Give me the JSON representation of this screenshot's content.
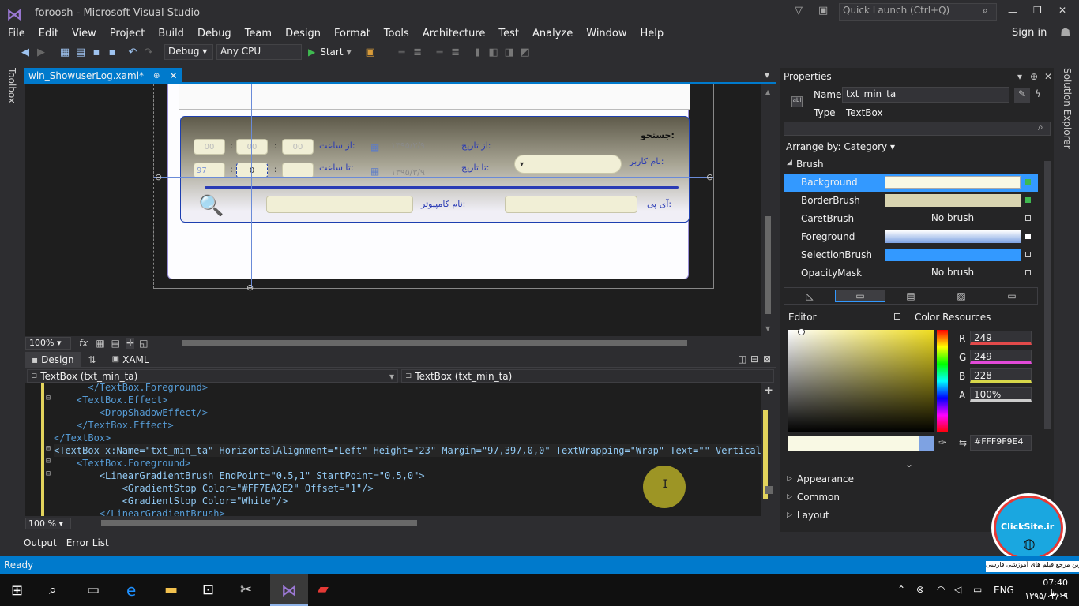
{
  "window": {
    "title": "foroosh - Microsoft Visual Studio",
    "quick_launch": "Quick Launch (Ctrl+Q)",
    "sign_in": "Sign in"
  },
  "menu": [
    "File",
    "Edit",
    "View",
    "Project",
    "Build",
    "Debug",
    "Team",
    "Design",
    "Format",
    "Tools",
    "Architecture",
    "Test",
    "Analyze",
    "Window",
    "Help"
  ],
  "toolbar": {
    "config": "Debug",
    "platform": "Any CPU",
    "start": "Start"
  },
  "side": {
    "toolbox": "Toolbox",
    "solution_explorer": "Solution Explorer"
  },
  "doc_tab": {
    "name": "win_ShowuserLog.xaml*",
    "pin": "⊕",
    "close": "✕"
  },
  "form": {
    "search_title": "جستجو:",
    "from_date_label": "از تاریخ:",
    "to_date_label": "تا تاریخ:",
    "from_time_label": "از ساعت:",
    "to_time_label": "تا ساعت:",
    "from_date": "۱۳۹۵/۳/۹",
    "to_date": "۱۳۹۵/۳/۹",
    "username_label": "نام کاربر:",
    "computer_label": "نام کامپیوتر:",
    "ip_label": "آی پی:",
    "from_time_h": "00",
    "from_time_m": "00",
    "from_time_s": "00",
    "to_time_h": "0",
    "to_time_m": "0",
    "to_time_s": "97",
    "sep": ":"
  },
  "designer": {
    "zoom": "100%",
    "design_tab": "Design",
    "xaml_tab": "XAML",
    "swap": "⇅"
  },
  "nav": {
    "left": "TextBox (txt_min_ta)",
    "right": "TextBox (txt_min_ta)"
  },
  "code": {
    "zoom": "100 %",
    "lines": [
      {
        "indent": "      ",
        "text": "</TextBox.Foreground>"
      },
      {
        "indent": "    ",
        "text": "<TextBox.Effect>"
      },
      {
        "indent": "        ",
        "text": "<DropShadowEffect/>"
      },
      {
        "indent": "    ",
        "text": "</TextBox.Effect>"
      },
      {
        "indent": "",
        "text": "</TextBox>"
      },
      {
        "indent": "",
        "text": "<TextBox x:Name=\"txt_min_ta\" HorizontalAlignment=\"Left\" Height=\"23\" Margin=\"97,397,0,0\" TextWrapping=\"Wrap\" Text=\"\" VerticalAlign"
      },
      {
        "indent": "    ",
        "text": "<TextBox.Foreground>"
      },
      {
        "indent": "        ",
        "text": "<LinearGradientBrush EndPoint=\"0.5,1\" StartPoint=\"0.5,0\">"
      },
      {
        "indent": "            ",
        "text": "<GradientStop Color=\"#FF7EA2E2\" Offset=\"1\"/>"
      },
      {
        "indent": "            ",
        "text": "<GradientStop Color=\"White\"/>"
      },
      {
        "indent": "        ",
        "text": "</LinearGradientBrush>"
      }
    ]
  },
  "output_tabs": [
    "Output",
    "Error List"
  ],
  "properties": {
    "header": "Properties",
    "name_label": "Name",
    "name_value": "txt_min_ta",
    "type_label": "Type",
    "type_value": "TextBox",
    "arrange_by": "Arrange by: Category ▾",
    "brush_group": "Brush",
    "brushes": [
      {
        "name": "Background",
        "value": "",
        "color": "#FFF9F9E4"
      },
      {
        "name": "BorderBrush",
        "value": "",
        "color": "#d8d4b0"
      },
      {
        "name": "CaretBrush",
        "value": "No brush",
        "color": ""
      },
      {
        "name": "Foreground",
        "value": "",
        "color": "#9ec3f0"
      },
      {
        "name": "SelectionBrush",
        "value": "",
        "color": "#3399ff"
      },
      {
        "name": "OpacityMask",
        "value": "No brush",
        "color": ""
      }
    ],
    "editor_label": "Editor",
    "color_resources": "Color Resources",
    "rgba": [
      {
        "ch": "R",
        "val": "249"
      },
      {
        "ch": "G",
        "val": "249"
      },
      {
        "ch": "B",
        "val": "228"
      },
      {
        "ch": "A",
        "val": "100%"
      }
    ],
    "hex": "#FFF9F9E4",
    "sections": [
      "Appearance",
      "Common",
      "Layout"
    ]
  },
  "status": {
    "text": "Ready",
    "watermark": "بزرگترین مرجع فیلم های آموزشی فارسی",
    "badge": "ClickSite.ir"
  },
  "taskbar": {
    "lang": "ENG",
    "time": "07:40 ب.ظ",
    "date": "۱۳۹۵/۰۳/۰۹"
  }
}
